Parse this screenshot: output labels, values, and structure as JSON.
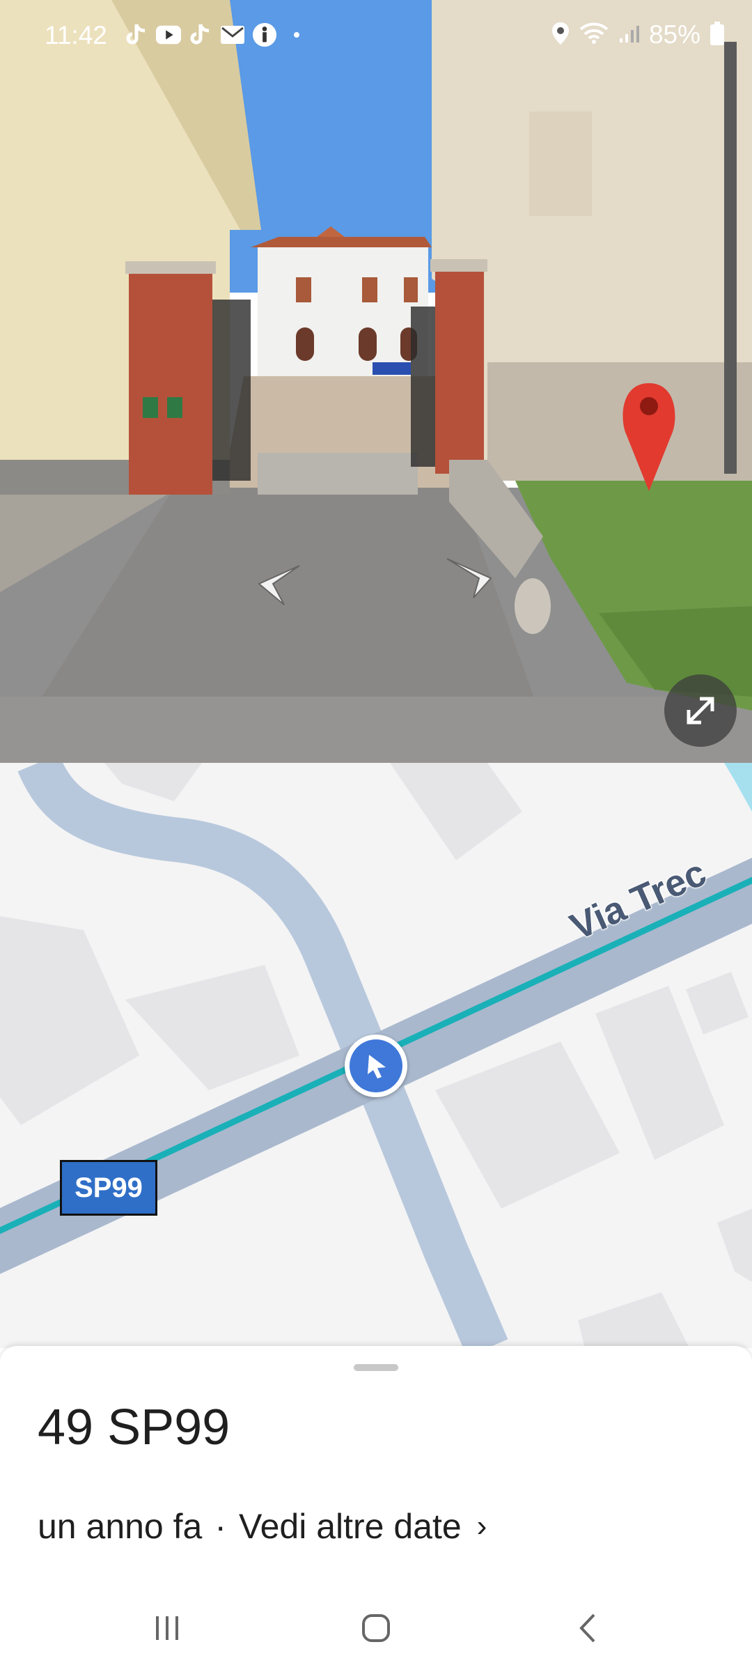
{
  "status_bar": {
    "time": "11:42",
    "battery": "85%",
    "left_icons": [
      "tiktok-icon",
      "youtube-icon",
      "tiktok-icon",
      "mail-icon",
      "info-icon",
      "dot-icon"
    ],
    "right_icons": [
      "location-icon",
      "wifi-icon",
      "signal-icon",
      "battery-icon"
    ]
  },
  "street_view": {
    "controls": [
      "arrow-left-icon",
      "arrow-right-icon",
      "expand-icon"
    ],
    "pin_color": "#d93025"
  },
  "map": {
    "road_shield": "SP99",
    "street_label": "Via Trec",
    "route_color": "#1ab0b8",
    "marker_color": "#3f78d8"
  },
  "sheet": {
    "title": "49 SP99",
    "age": "un anno fa",
    "separator": "·",
    "more_dates": "Vedi altre date",
    "chevron": "›"
  },
  "nav_bar": {
    "buttons": [
      "recents-icon",
      "home-icon",
      "back-icon"
    ]
  }
}
